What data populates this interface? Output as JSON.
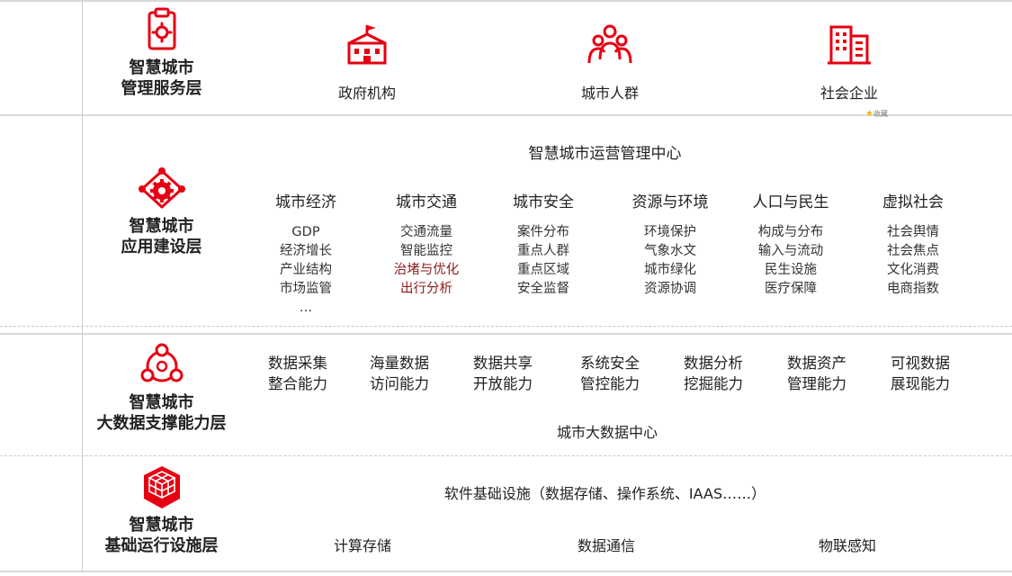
{
  "layers": [
    {
      "name_line1": "智慧城市",
      "name_line2": "管理服务层",
      "icon": "clipboard-gear-icon"
    },
    {
      "name_line1": "智慧城市",
      "name_line2": "应用建设层",
      "icon": "network-gear-icon"
    },
    {
      "name_line1": "智慧城市",
      "name_line2": "大数据支撑能力层",
      "icon": "cycle-nodes-icon"
    },
    {
      "name_line1": "智慧城市",
      "name_line2": "基础运行设施层",
      "icon": "cube-stack-icon"
    }
  ],
  "management": {
    "items": [
      {
        "label": "政府机构",
        "icon": "government-building-icon"
      },
      {
        "label": "城市人群",
        "icon": "people-group-icon"
      },
      {
        "label": "社会企业",
        "icon": "office-buildings-icon"
      }
    ]
  },
  "application": {
    "center": "智慧城市运营管理中心",
    "columns": [
      {
        "title": "城市经济",
        "items": [
          "GDP",
          "经济增长",
          "产业结构",
          "市场监管",
          "…"
        ]
      },
      {
        "title": "城市交通",
        "items": [
          "交通流量",
          "智能监控",
          "治堵与优化",
          "出行分析"
        ]
      },
      {
        "title": "城市安全",
        "items": [
          "案件分布",
          "重点人群",
          "重点区域",
          "安全监督"
        ]
      },
      {
        "title": "资源与环境",
        "items": [
          "环境保护",
          "气象水文",
          "城市绿化",
          "资源协调"
        ]
      },
      {
        "title": "人口与民生",
        "items": [
          "构成与分布",
          "输入与流动",
          "民生设施",
          "医疗保障"
        ]
      },
      {
        "title": "虚拟社会",
        "items": [
          "社会舆情",
          "社会焦点",
          "文化消费",
          "电商指数"
        ]
      }
    ]
  },
  "bigdata": {
    "capabilities": [
      {
        "line1": "数据采集",
        "line2": "整合能力"
      },
      {
        "line1": "海量数据",
        "line2": "访问能力"
      },
      {
        "line1": "数据共享",
        "line2": "开放能力"
      },
      {
        "line1": "系统安全",
        "line2": "管控能力"
      },
      {
        "line1": "数据分析",
        "line2": "挖掘能力"
      },
      {
        "line1": "数据资产",
        "line2": "管理能力"
      },
      {
        "line1": "可视数据",
        "line2": "展现能力"
      }
    ],
    "center": "城市大数据中心"
  },
  "infrastructure": {
    "software": "软件基础设施（数据存储、操作系统、IAAS……）",
    "items": [
      "计算存储",
      "数据通信",
      "物联感知"
    ]
  },
  "stamp": "收藏",
  "colors": {
    "accent": "#e60012",
    "highlight_text": "#8b1a1a"
  }
}
